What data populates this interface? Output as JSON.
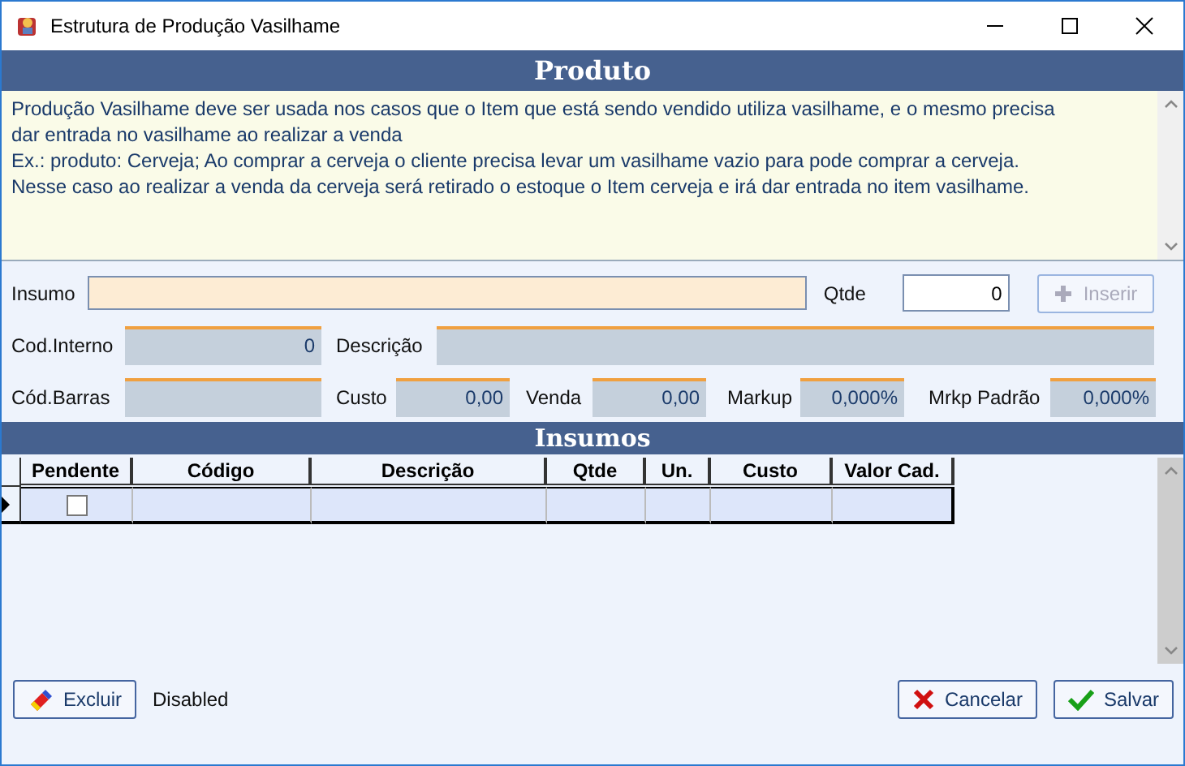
{
  "window": {
    "title": "Estrutura de Produção Vasilhame"
  },
  "produto": {
    "header": "Produto",
    "description_lines": [
      "Produção Vasilhame deve ser usada nos casos que o Item que está sendo vendido utiliza vasilhame, e o mesmo precisa",
      "dar entrada no vasilhame ao realizar a venda",
      "Ex.: produto: Cerveja; Ao comprar a cerveja o cliente precisa levar um vasilhame vazio para pode comprar a cerveja.",
      "Nesse caso ao realizar a venda da cerveja será retirado o estoque o Item cerveja e irá dar entrada no item vasilhame."
    ]
  },
  "form": {
    "insumo": {
      "label": "Insumo"
    },
    "qtde": {
      "label": "Qtde",
      "value": "0"
    },
    "inserir": {
      "label": "Inserir",
      "disabled": true
    },
    "cod_interno": {
      "label": "Cod.Interno",
      "value": "0"
    },
    "descricao": {
      "label": "Descrição"
    },
    "cod_barras": {
      "label": "Cód.Barras"
    },
    "custo": {
      "label": "Custo",
      "value": "0,00"
    },
    "venda": {
      "label": "Venda",
      "value": "0,00"
    },
    "markup": {
      "label": "Markup",
      "value": "0,000%"
    },
    "mrkp_padrao": {
      "label": "Mrkp Padrão",
      "value": "0,000%"
    }
  },
  "insumos": {
    "header": "Insumos",
    "columns": [
      "Pendente",
      "Código",
      "Descrição",
      "Qtde",
      "Un.",
      "Custo",
      "Valor Cad."
    ],
    "rows": [
      {
        "selected": true,
        "pendente": false
      }
    ]
  },
  "footer": {
    "excluir": "Excluir",
    "status": "Disabled",
    "cancelar": "Cancelar",
    "salvar": "Salvar"
  }
}
